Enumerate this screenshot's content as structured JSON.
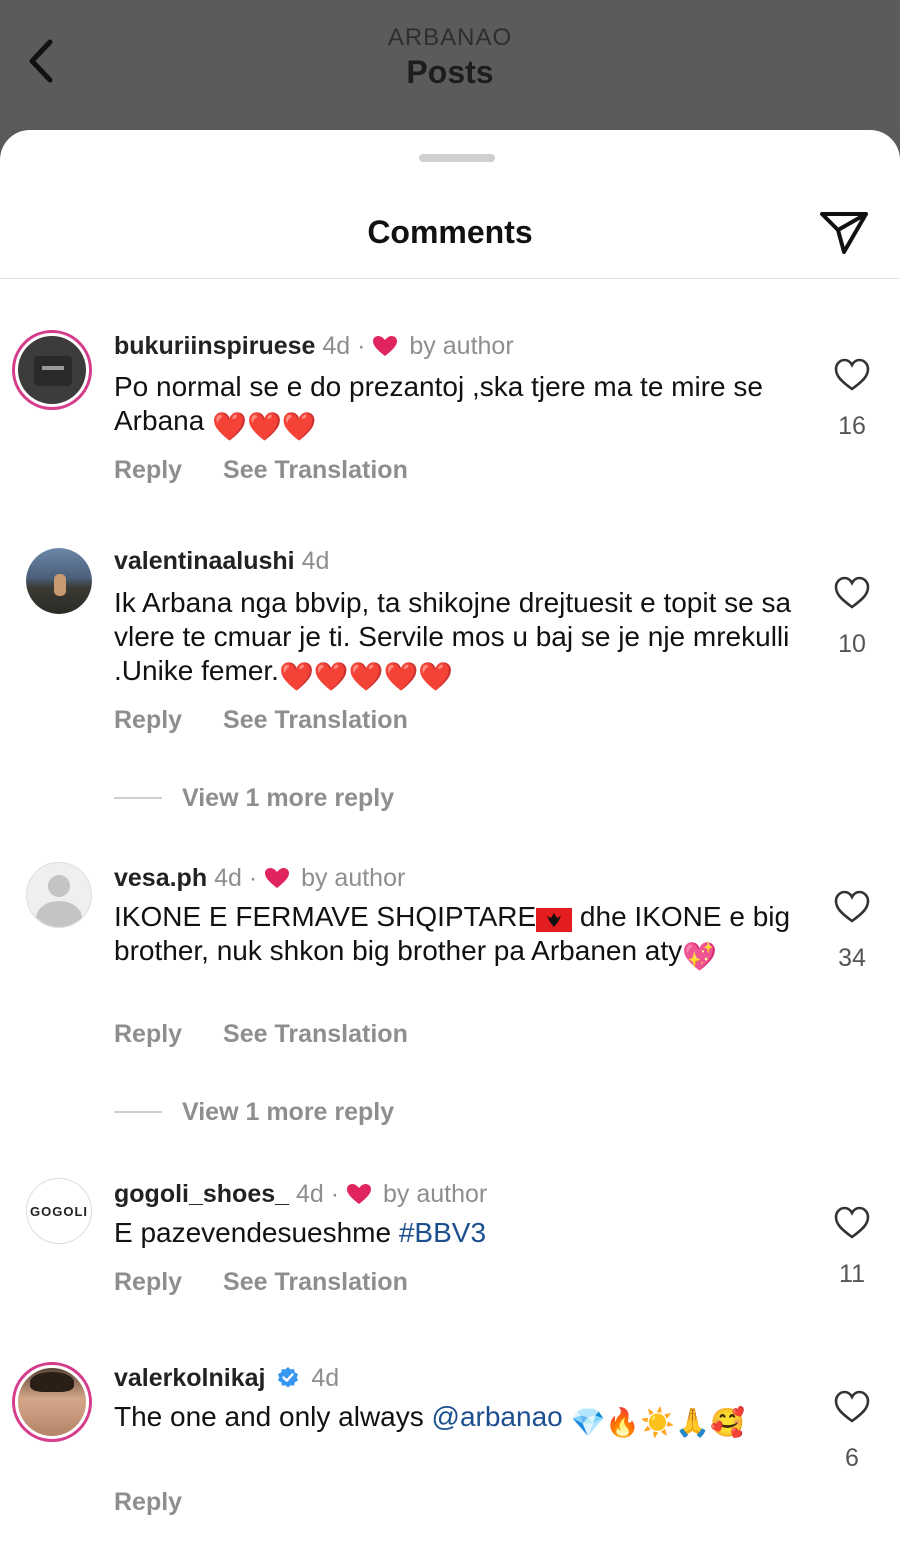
{
  "header": {
    "account": "ARBANAO",
    "title": "Posts"
  },
  "sheet": {
    "title": "Comments"
  },
  "comments": [
    {
      "user": "bukuriinspiruese",
      "time": "4d",
      "liked_by_author": true,
      "author_label": "by author",
      "text": "Po normal se e do prezantoj ,ska tjere ma te mire se Arbana",
      "likes": "16",
      "reply": "Reply",
      "translate": "See Translation"
    },
    {
      "user": "valentinaalushi",
      "time": "4d",
      "liked_by_author": false,
      "text": "Ik Arbana nga  bbvip, ta shikojne drejtuesit e topit se sa vlere te cmuar je ti. Servile mos u baj se je nje mrekulli .Unike femer.",
      "likes": "10",
      "reply": "Reply",
      "translate": "See Translation",
      "more_replies": "View 1 more reply"
    },
    {
      "user": "vesa.ph",
      "time": "4d",
      "liked_by_author": true,
      "author_label": "by author",
      "text_a": "IKONE E FERMAVE SHQIPTARE",
      "text_b": " dhe IKONE e big brother, nuk shkon big brother pa Arbanen aty",
      "likes": "34",
      "reply": "Reply",
      "translate": "See Translation",
      "more_replies": "View 1 more reply"
    },
    {
      "user": "gogoli_shoes_",
      "time": "4d",
      "liked_by_author": true,
      "author_label": "by author",
      "text": "E pazevendesueshme ",
      "hashtag": "#BBV3",
      "likes": "11",
      "reply": "Reply",
      "translate": "See Translation",
      "avatar_text": "GOGOLI"
    },
    {
      "user": "valerkolnikaj",
      "time": "4d",
      "verified": true,
      "text": "The one and only always  ",
      "mention": "@arbanao",
      "likes": "6",
      "reply": "Reply"
    }
  ],
  "colors": {
    "heart_red": "#e0245e",
    "link_blue": "#1d4f8f",
    "verified_blue": "#3897f0",
    "story_ring": "#d63c8c"
  },
  "icons": [
    "back-chevron-icon",
    "share-send-icon",
    "heart-outline-icon",
    "red-heart-icon",
    "verified-badge-icon"
  ]
}
